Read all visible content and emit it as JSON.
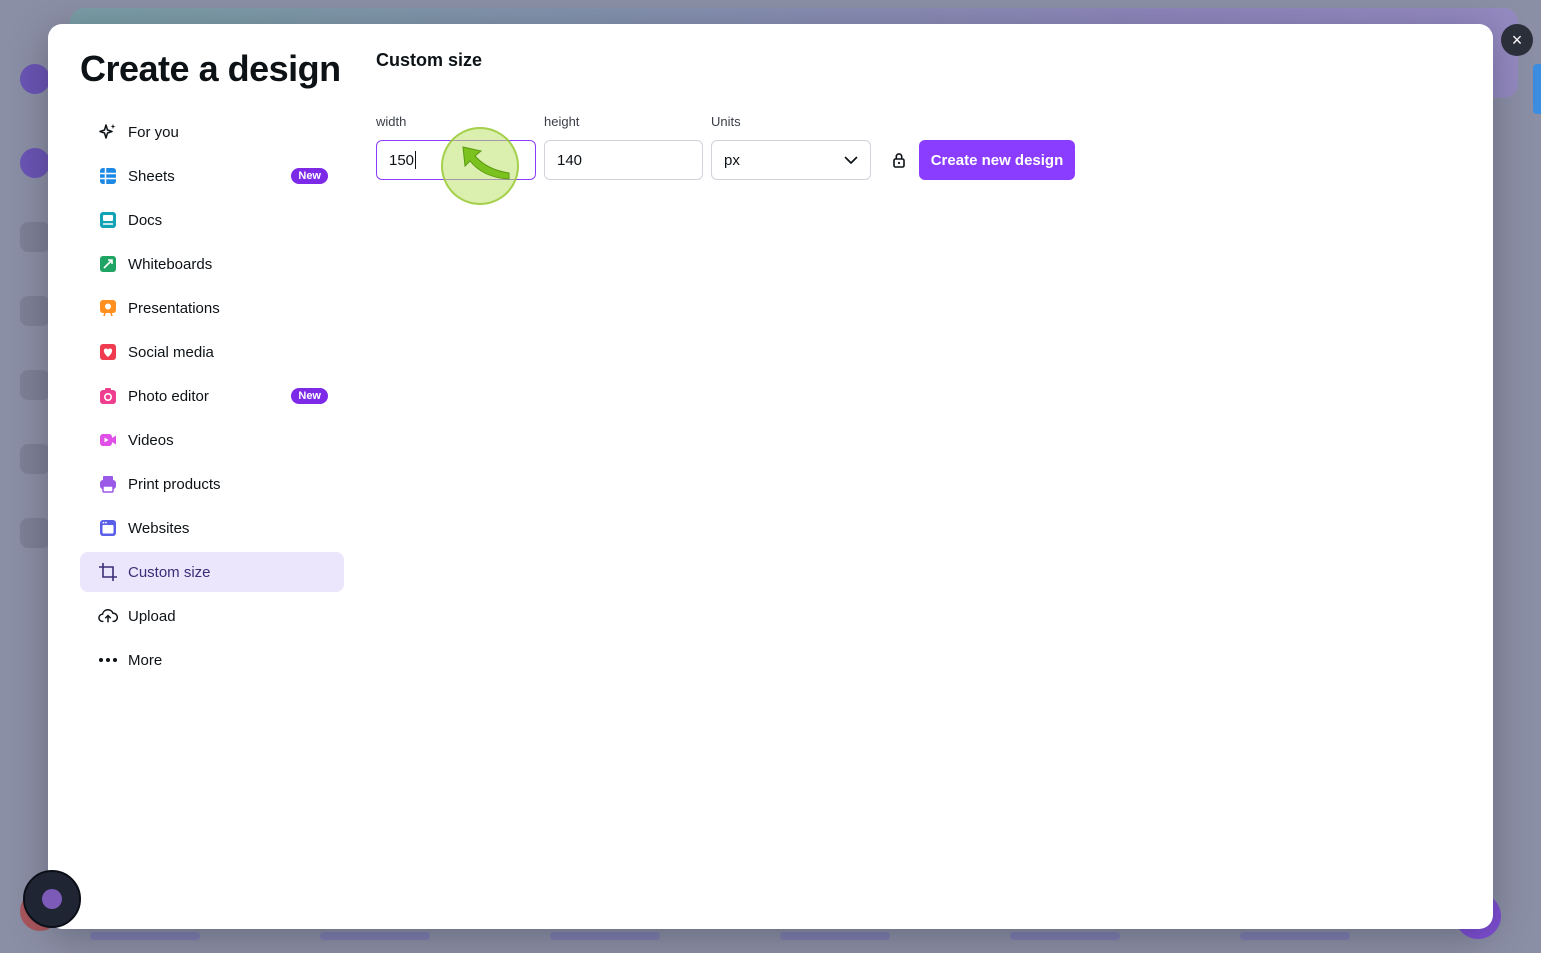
{
  "modal": {
    "title": "Create a design",
    "close_label": "×"
  },
  "nav": {
    "items": [
      {
        "label": "For you",
        "icon": "sparkle-icon"
      },
      {
        "label": "Sheets",
        "icon": "sheets-icon",
        "badge": "New"
      },
      {
        "label": "Docs",
        "icon": "docs-icon"
      },
      {
        "label": "Whiteboards",
        "icon": "whiteboard-icon"
      },
      {
        "label": "Presentations",
        "icon": "presentation-icon"
      },
      {
        "label": "Social media",
        "icon": "heart-icon"
      },
      {
        "label": "Photo editor",
        "icon": "camera-icon",
        "badge": "New"
      },
      {
        "label": "Videos",
        "icon": "video-icon"
      },
      {
        "label": "Print products",
        "icon": "printer-icon"
      },
      {
        "label": "Websites",
        "icon": "website-icon"
      },
      {
        "label": "Custom size",
        "icon": "crop-icon",
        "active": true
      },
      {
        "label": "Upload",
        "icon": "upload-cloud-icon"
      },
      {
        "label": "More",
        "icon": "more-dots-icon"
      }
    ]
  },
  "custom_size": {
    "title": "Custom size",
    "width_label": "width",
    "width_value": "150",
    "height_label": "height",
    "height_value": "140",
    "units_label": "Units",
    "units_value": "px",
    "create_button": "Create new design"
  },
  "colors": {
    "accent": "#8b3dff",
    "badge": "#7d2ae8",
    "active_nav_bg": "#ece6fd"
  }
}
